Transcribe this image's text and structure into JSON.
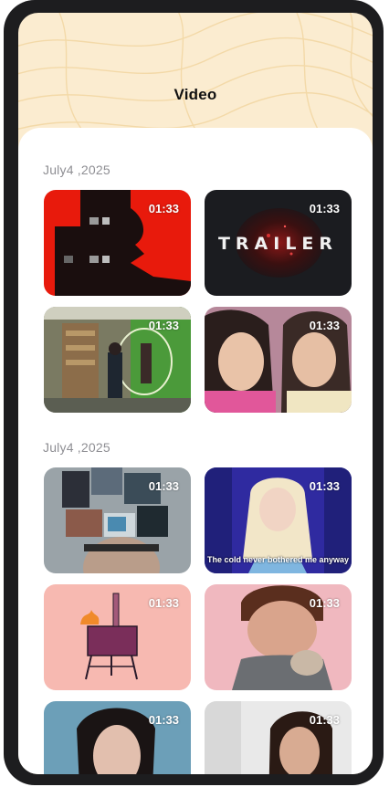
{
  "header": {
    "title": "Video"
  },
  "colors": {
    "header_bg": "#fbecd0",
    "pattern_stroke": "#f3d9a8",
    "date_text": "#8e8e93",
    "device_frame": "#1d1d1f"
  },
  "sections": [
    {
      "date": "July4 ,2025",
      "videos": [
        {
          "duration": "01:33",
          "thumbnail": "red-silhouette-building"
        },
        {
          "duration": "01:33",
          "thumbnail": "trailer-title-card",
          "overlay_text": "TRAILER"
        },
        {
          "duration": "01:33",
          "thumbnail": "green-screen-studio"
        },
        {
          "duration": "01:33",
          "thumbnail": "two-girls-pink"
        }
      ]
    },
    {
      "date": "July4 ,2025",
      "videos": [
        {
          "duration": "01:33",
          "thumbnail": "head-collage"
        },
        {
          "duration": "01:33",
          "thumbnail": "animated-princess",
          "caption": "The cold never bothered me anyway"
        },
        {
          "duration": "01:33",
          "thumbnail": "pizza-oven-illustration"
        },
        {
          "duration": "01:33",
          "thumbnail": "man-with-puppy"
        },
        {
          "duration": "01:33",
          "thumbnail": "woman-portrait"
        },
        {
          "duration": "01:33",
          "thumbnail": "woman-eating"
        }
      ]
    }
  ]
}
